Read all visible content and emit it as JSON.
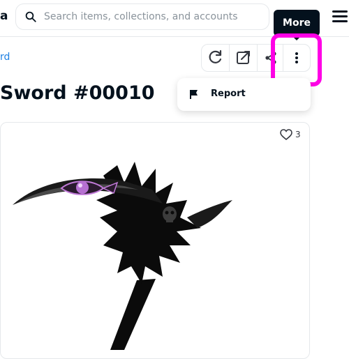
{
  "header": {
    "logo_fragment": "a",
    "search_placeholder": "Search items, collections, and accounts"
  },
  "tooltip": {
    "text": "More"
  },
  "breadcrumb": {
    "text": "rd"
  },
  "actions": {
    "items": [
      {
        "name": "refresh-icon"
      },
      {
        "name": "external-link-icon"
      },
      {
        "name": "share-icon"
      },
      {
        "name": "more-vertical-icon"
      }
    ]
  },
  "menu": {
    "items": [
      {
        "label": "Report",
        "icon": "flag-icon"
      }
    ]
  },
  "item": {
    "title": "Sword #00010",
    "favorites": "3",
    "image": "scythe-artwork"
  },
  "colors": {
    "highlight": "#ff00e6",
    "tooltip_bg": "#04111d",
    "link": "#2081e2"
  }
}
